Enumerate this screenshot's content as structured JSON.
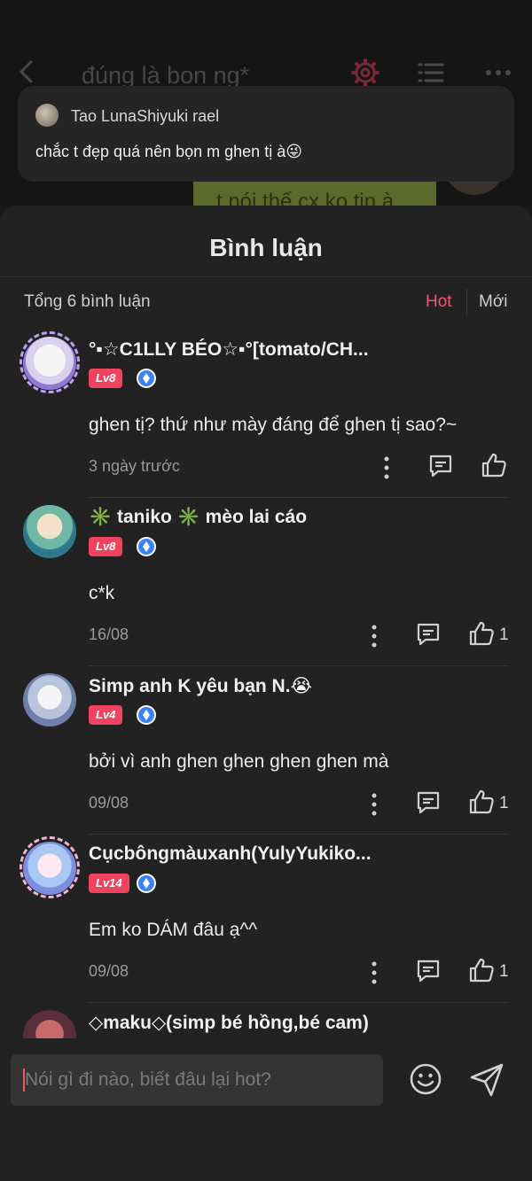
{
  "background": {
    "title": "đúng là bon ng*",
    "bubble_text": "t nói thế cx ko tin à"
  },
  "toast": {
    "name": "Tao LunaShiyuki rael",
    "message": "chắc t đẹp quá nên bọn m ghen tị à😜"
  },
  "sheet": {
    "title": "Bình luận",
    "count": "Tổng 6 bình luận",
    "sort_hot": "Hot",
    "sort_new": "Mới"
  },
  "comments": [
    {
      "name": "°▪☆C1LLY BÉO☆▪°[tomato/CH...",
      "level": "Lv8",
      "text": "ghen tị? thứ như mày đáng để ghen tị sao?~",
      "time": "3 ngày trước",
      "likes": ""
    },
    {
      "name": "✳️ taniko ✳️ mèo lai cáo",
      "level": "Lv8",
      "text": "c*k",
      "time": "16/08",
      "likes": "1"
    },
    {
      "name": "Simp anh K yêu bạn N.😭",
      "level": "Lv4",
      "text": "bởi vì anh ghen ghen ghen ghen mà",
      "time": "09/08",
      "likes": "1"
    },
    {
      "name": "Cụcbôngmàuxanh(YulyYukiko...",
      "level": "Lv14",
      "text": "Em ko DÁM đâu ạ^^",
      "time": "09/08",
      "likes": "1"
    },
    {
      "name": "◇maku◇(simp bé hồng,bé cam)",
      "level": "",
      "text": "",
      "time": "",
      "likes": ""
    }
  ],
  "input": {
    "placeholder": "Nói gì đi nào, biết đâu lại hot?"
  },
  "colors": {
    "accent": "#f2556a",
    "level_badge": "#f0435d",
    "verified": "#3b82f6",
    "sheet_bg": "#222222"
  }
}
